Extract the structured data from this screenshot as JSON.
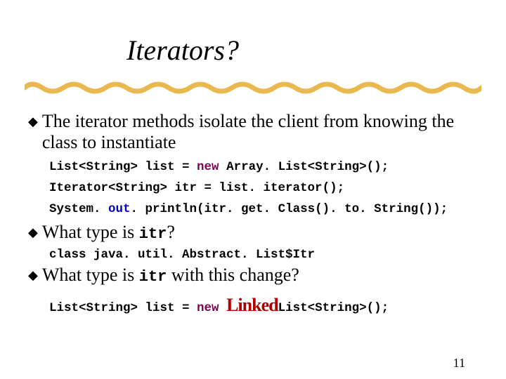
{
  "title": "Iterators?",
  "bullet1": "The iterator methods isolate the client from knowing the class to instantiate",
  "code1_a": "List<String> list = ",
  "code1_new": "new",
  "code1_b": " Array. List<String>();",
  "code2": "Iterator<String> itr = list. iterator();",
  "code3_a": "System. ",
  "code3_out": "out",
  "code3_b": ". println(itr. get. Class(). to. String());",
  "bullet2_a": "What type is ",
  "bullet2_code": "itr",
  "bullet2_b": "?",
  "code4": "class java. util. Abstract. List$Itr",
  "bullet3_a": "What type is ",
  "bullet3_code": "itr",
  "bullet3_b": " with this change?",
  "code5_a": "List<String> list = ",
  "code5_new": "new",
  "code5_b": " ",
  "code5_linked": "Linked",
  "code5_c": "List<String>();",
  "page": "11"
}
